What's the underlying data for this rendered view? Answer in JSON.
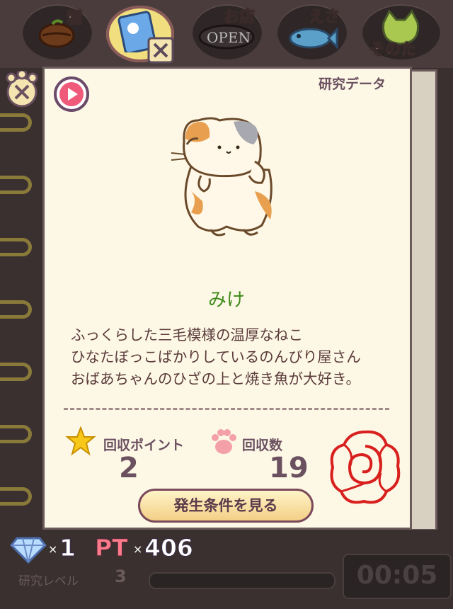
{
  "tabs": [
    {
      "label": "種",
      "icon": "seed-icon"
    },
    {
      "label": "",
      "icon": "notebook-icon"
    },
    {
      "label": "お店",
      "icon": "shop-open-sign-icon",
      "sign": "OPEN"
    },
    {
      "label": "えさ",
      "icon": "fish-icon"
    },
    {
      "label": "そのた",
      "icon": "cat-face-icon"
    }
  ],
  "card": {
    "research_title": "研究データ",
    "cat_name": "みけ",
    "description": [
      "ふっくらした三毛模様の温厚なねこ",
      "ひなたぼっこばかりしているのんびり屋さん",
      "おばあちゃんのひざの上と焼き魚が大好き。"
    ],
    "collect_points_label": "回収ポイント",
    "collect_points_value": "2",
    "collect_count_label": "回収数",
    "collect_count_value": "19",
    "condition_button": "発生条件を見る"
  },
  "status": {
    "gem_times": "×",
    "gem_count": "1",
    "pt_label": "PT",
    "pt_times": "×",
    "pt_count": "406",
    "level_label": "研究レベル",
    "level_value": "3",
    "timer": "00:05"
  },
  "colors": {
    "name_green": "#3f8a1a",
    "text_brown": "#5a3a3a",
    "stamp_red": "#d8201e",
    "pt_pink": "#ff7a8a"
  }
}
